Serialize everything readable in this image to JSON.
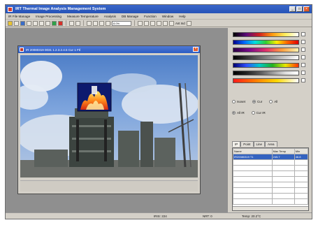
{
  "window": {
    "title": "IRT Thermal Image Analysis Management System",
    "buttons": [
      "_",
      "□",
      "×"
    ]
  },
  "menu": [
    "IR File Manage",
    "Image Processing",
    "Measure Temperature",
    "Analysis",
    "DB Manage",
    "Function",
    "Window",
    "Help"
  ],
  "toolbar": {
    "combo_value": "8.0%",
    "right_label": "Ant  Ind"
  },
  "child_window": {
    "title": "IR 20080319 0031 1.2.3.2.4.5  Cur 1 Ftl",
    "close": "×"
  },
  "colors": {
    "accent": "#2553b8",
    "workspace": "#8f8f8f",
    "panel": "#d4d0c8"
  },
  "right_panel": {
    "radio_row1": [
      {
        "label": "Isoset",
        "checked": false
      },
      {
        "label": "Cur",
        "checked": true
      },
      {
        "label": "All",
        "checked": false
      }
    ],
    "radio_row2": [
      {
        "label": "All IR",
        "checked": true
      },
      {
        "label": "Cur IR",
        "checked": false
      }
    ],
    "tabs": [
      "IP",
      "Point",
      "Line",
      "Area"
    ],
    "table": {
      "headers": [
        "Name",
        "Max Temp",
        "Min"
      ],
      "rows": [
        [
          "IR20080319 T1",
          "245.7",
          "46.8"
        ]
      ]
    }
  },
  "status": {
    "cell1": "IRIS: 224",
    "cell2": "NRT: 0",
    "cell3": "Temp: 20.2°C"
  }
}
